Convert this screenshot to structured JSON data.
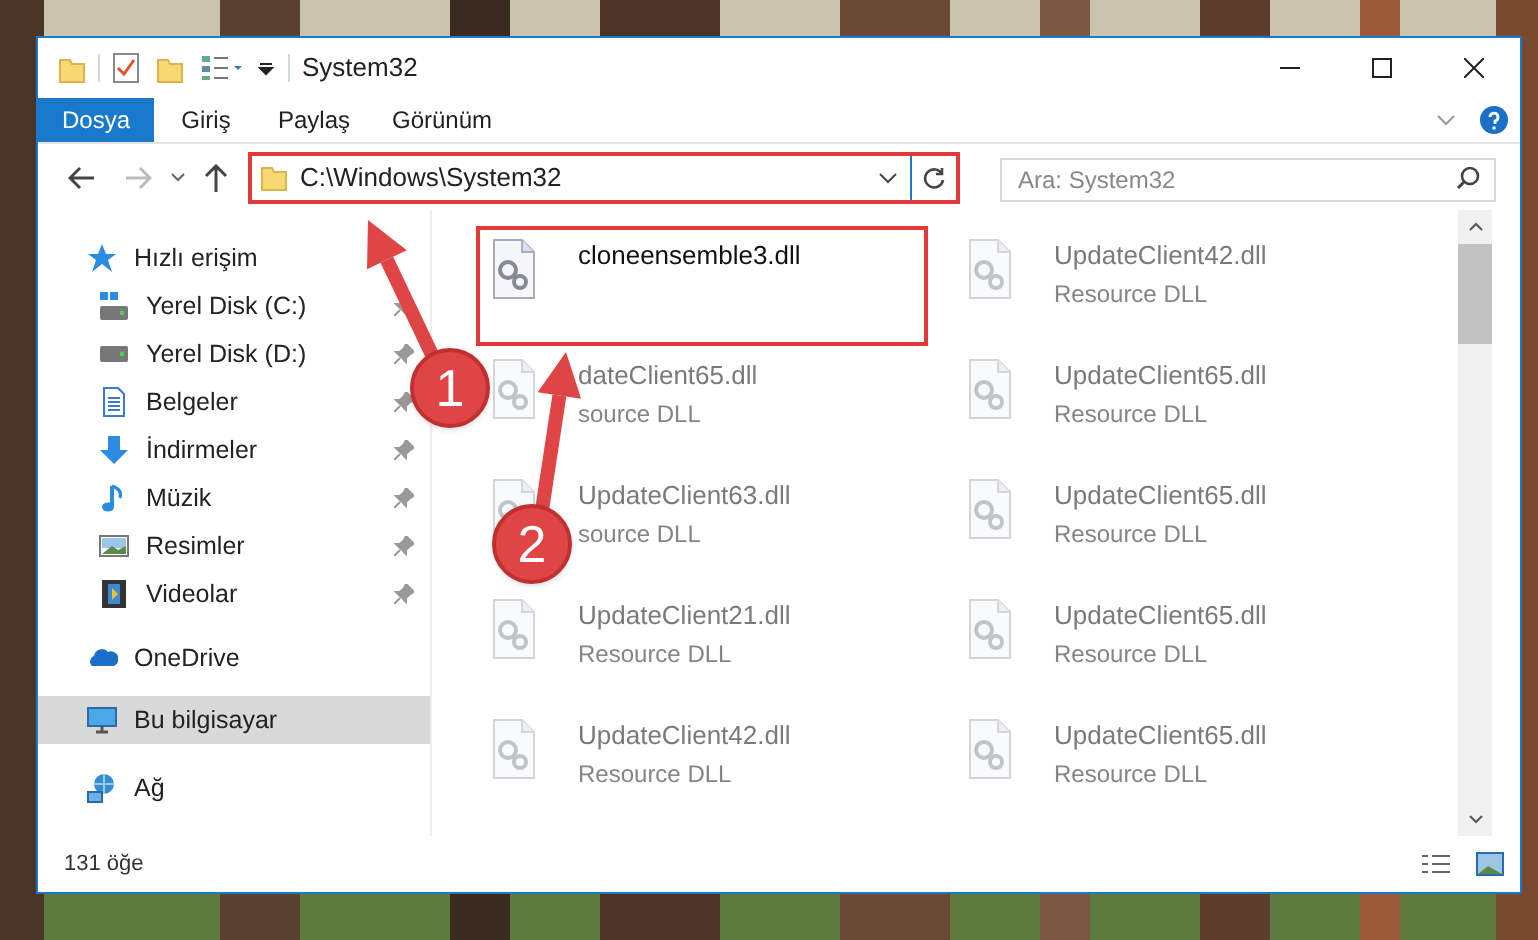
{
  "window": {
    "title": "System32"
  },
  "ribbon_tabs": [
    {
      "label": "Dosya",
      "selected": true
    },
    {
      "label": "Giriş",
      "selected": false
    },
    {
      "label": "Paylaş",
      "selected": false
    },
    {
      "label": "Görünüm",
      "selected": false
    }
  ],
  "address": {
    "path": "C:\\Windows\\System32"
  },
  "search": {
    "placeholder": "Ara: System32"
  },
  "nav": [
    {
      "label": "Hızlı erişim",
      "selected": false,
      "children": [
        {
          "label": "Yerel Disk (C:)",
          "selected": false,
          "pinned": true
        },
        {
          "label": "Yerel Disk (D:)",
          "selected": false,
          "pinned": true
        },
        {
          "label": "Belgeler",
          "selected": false,
          "pinned": true
        },
        {
          "label": "İndirmeler",
          "selected": false,
          "pinned": true
        },
        {
          "label": "Müzik",
          "selected": false,
          "pinned": true
        },
        {
          "label": "Resimler",
          "selected": false,
          "pinned": true
        },
        {
          "label": "Videolar",
          "selected": false,
          "pinned": true
        }
      ]
    },
    {
      "label": "OneDrive",
      "selected": false
    },
    {
      "label": "Bu bilgisayar",
      "selected": true
    },
    {
      "label": "Ağ",
      "selected": false
    }
  ],
  "files": [
    {
      "name": "cloneensemble3.dll",
      "blurred": false
    },
    {
      "name": "UpdateClient42.dll",
      "type": "Resource DLL",
      "blurred": true
    },
    {
      "name": "dateClient65.dll",
      "type": "source DLL",
      "blurred": true
    },
    {
      "name": "UpdateClient65.dll",
      "type": "Resource DLL",
      "blurred": true
    },
    {
      "name": "UpdateClient63.dll",
      "type": "source DLL",
      "blurred": true
    },
    {
      "name": "UpdateClient65.dll",
      "type": "Resource DLL",
      "blurred": true
    },
    {
      "name": "UpdateClient21.dll",
      "type": "Resource DLL",
      "blurred": true
    },
    {
      "name": "UpdateClient65.dll",
      "type": "Resource DLL",
      "blurred": true
    },
    {
      "name": "UpdateClient42.dll",
      "type": "Resource DLL",
      "blurred": true
    },
    {
      "name": "UpdateClient65.dll",
      "type": "Resource DLL",
      "blurred": true
    }
  ],
  "status_bar": {
    "count": "131 öğe"
  },
  "callouts": [
    {
      "number": "1"
    },
    {
      "number": "2"
    }
  ]
}
